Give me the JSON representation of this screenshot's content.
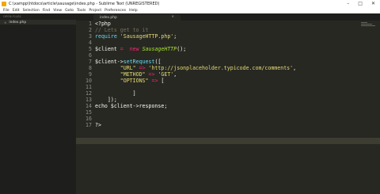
{
  "window": {
    "title": "C:\\xampp\\htdocs\\article\\sausage\\index.php - Sublime Text (UNREGISTERED)",
    "controls": {
      "minimize": "–",
      "maximize": "□",
      "close": "✕"
    }
  },
  "menu": [
    "File",
    "Edit",
    "Selection",
    "Find",
    "View",
    "Goto",
    "Tools",
    "Project",
    "Preferences",
    "Help"
  ],
  "sidebar": {
    "header": "OPEN FILES",
    "file_close": "×",
    "file": "index.php"
  },
  "tab": {
    "label": "index.php",
    "close": "×"
  },
  "editor": {
    "line_numbers": [
      "1",
      "2",
      "3",
      "4",
      "5",
      "6",
      "7",
      "8",
      "9",
      "10",
      "11",
      "12",
      "13",
      "14",
      "15",
      "16",
      "17"
    ],
    "lines": {
      "l1": "<?php",
      "l2": "// Lets get to it",
      "l3_fn": "require",
      "l3_str": "'SausageHTTP.php'",
      "l3_end": ";",
      "l5_var": "$client",
      "l5_eq": " = ",
      "l5_new": " new ",
      "l5_cls": "SausageHTTP",
      "l5_end": "();",
      "l7_var": "$client->",
      "l7_fn": "setRequest",
      "l7_end": "([",
      "l8_key": "\"URL\"",
      "l8_arrow": " => ",
      "l8_val": "'http://jsonplaceholder.typicode.com/comments'",
      "l8_end": ",",
      "l9_key": "\"METHOD\"",
      "l9_arrow": " => ",
      "l9_val": "'GET'",
      "l9_end": ",",
      "l10_key": "\"OPTIONS\"",
      "l10_arrow": " => ",
      "l10_end": "[",
      "l12": "]",
      "l13": "]);",
      "l14": "echo $client->response;",
      "l17": "?>"
    }
  },
  "colors": {
    "background": "#272822",
    "comment": "#75715e",
    "string": "#e6db74",
    "keyword": "#f92672",
    "function": "#66d9ef",
    "class": "#a6e22e"
  }
}
